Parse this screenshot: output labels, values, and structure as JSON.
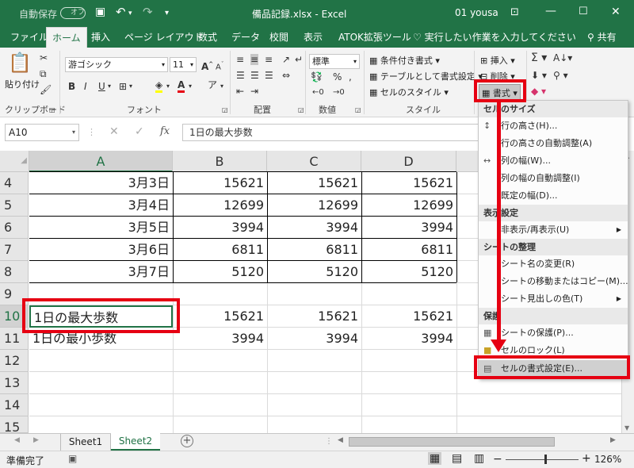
{
  "titlebar": {
    "autosave": "自動保存",
    "autosave_state": "オフ",
    "title": "備品記録.xlsx  -  Excel",
    "user": "01 yousa"
  },
  "tabs": [
    "ファイル",
    "ホーム",
    "挿入",
    "ページ レイアウト",
    "数式",
    "データ",
    "校閲",
    "表示",
    "ATOK拡張ツール"
  ],
  "tell_me": "実行したい作業を入力してください",
  "share": "共有",
  "ribbon": {
    "paste": "貼り付け",
    "clipboard": "クリップボード",
    "font_name": "游ゴシック",
    "font_size": "11",
    "font_group": "フォント",
    "align_group": "配置",
    "number_format": "標準",
    "number_group": "数値",
    "cond_format": "条件付き書式",
    "table_format": "テーブルとして書式設定",
    "cell_styles": "セルのスタイル",
    "style_group": "スタイル",
    "insert": "挿入",
    "delete": "削除",
    "format": "書式",
    "bold": "B",
    "italic": "I",
    "underline": "U",
    "fontsize_up": "A",
    "fontsize_down": "A",
    "font_color": "A",
    "fill_color": "A",
    "percent": "%",
    "comma": ","
  },
  "formula": {
    "namebox": "A10",
    "fx": "fx",
    "content": "1日の最大歩数"
  },
  "columns": [
    "A",
    "B",
    "C",
    "D"
  ],
  "rows": [
    {
      "n": "4",
      "a": "3月3日",
      "b": "15621",
      "c": "15621",
      "d": "15621"
    },
    {
      "n": "5",
      "a": "3月4日",
      "b": "12699",
      "c": "12699",
      "d": "12699"
    },
    {
      "n": "6",
      "a": "3月5日",
      "b": "3994",
      "c": "3994",
      "d": "3994"
    },
    {
      "n": "7",
      "a": "3月6日",
      "b": "6811",
      "c": "6811",
      "d": "6811"
    },
    {
      "n": "8",
      "a": "3月7日",
      "b": "5120",
      "c": "5120",
      "d": "5120"
    },
    {
      "n": "9",
      "a": "",
      "b": "",
      "c": "",
      "d": ""
    },
    {
      "n": "10",
      "a": "1日の最大歩数",
      "b": "15621",
      "c": "15621",
      "d": "15621"
    },
    {
      "n": "11",
      "a": "1日の最小歩数",
      "b": "3994",
      "c": "3994",
      "d": "3994"
    },
    {
      "n": "12",
      "a": "",
      "b": "",
      "c": "",
      "d": ""
    },
    {
      "n": "13",
      "a": "",
      "b": "",
      "c": "",
      "d": ""
    },
    {
      "n": "14",
      "a": "",
      "b": "",
      "c": "",
      "d": ""
    },
    {
      "n": "15",
      "a": "",
      "b": "",
      "c": "",
      "d": ""
    }
  ],
  "sheets": [
    "Sheet1",
    "Sheet2"
  ],
  "status": {
    "ready": "準備完了",
    "zoom": "126%"
  },
  "menu": {
    "h_size": "セルのサイズ",
    "row_height": "行の高さ(H)...",
    "autofit_row": "行の高さの自動調整(A)",
    "col_width": "列の幅(W)...",
    "autofit_col": "列の幅の自動調整(I)",
    "default_width": "既定の幅(D)...",
    "h_visibility": "表示設定",
    "hide_unhide": "非表示/再表示(U)",
    "h_organize": "シートの整理",
    "rename": "シート名の変更(R)",
    "move_copy": "シートの移動またはコピー(M)...",
    "tab_color": "シート見出しの色(T)",
    "h_protect": "保護",
    "protect_sheet": "シートの保護(P)...",
    "lock_cell": "セルのロック(L)",
    "format_cells": "セルの書式設定(E)..."
  },
  "colors": {
    "excel_green": "#217346",
    "highlight_red": "#e60012"
  }
}
